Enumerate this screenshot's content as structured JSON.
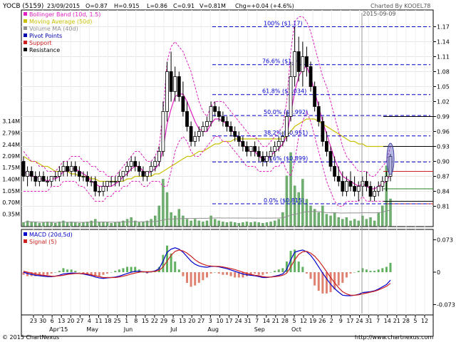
{
  "header": {
    "symbol": "YOCB (5159)",
    "date": "23/09/2015",
    "open": "O=0.87",
    "high": "H=0.915",
    "low": "L=0.86",
    "close": "C=0.91",
    "volume": "V=0.81M",
    "change": "Chg=+0.04 (+4.6%)",
    "charted_by": "Charted By KOOEL78",
    "date_marker": "2015-09-09",
    "copyright": "© 2015 ChartNexus",
    "website": "http://www.chartnexus.com"
  },
  "legend": [
    {
      "label": "Bollinger Band (10d, 1.5)",
      "color": "#e020c0"
    },
    {
      "label": "Moving Average (50d)",
      "color": "#c8c000"
    },
    {
      "label": "Volume MA (40d)",
      "color": "#909090"
    },
    {
      "label": "Pivot Points",
      "color": "#0000aa"
    },
    {
      "label": "Support",
      "color": "#cc2020"
    },
    {
      "label": "Resistance",
      "color": "#000000"
    }
  ],
  "macd_legend": [
    {
      "label": "MACD (20d,5d)",
      "color": "#0000cc"
    },
    {
      "label": "Signal (5)",
      "color": "#cc2020"
    }
  ],
  "colors": {
    "fib": "#0000cc",
    "bb": "#e020c0",
    "ma": "#c8c000",
    "volume": "#70b070",
    "macd_pos": "#60b060",
    "macd_neg": "#e08070",
    "highlight": "#6060c0"
  },
  "chart_data": [
    {
      "type": "candlestick",
      "title": "YOCB (5159)",
      "ylim": [
        0.795,
        1.195
      ],
      "right_ticks": [
        "1.17",
        "1.14",
        "1.11",
        "1.08",
        "1.05",
        "1.02",
        "0.99",
        "0.96",
        "0.93",
        "0.90",
        "0.87",
        "0.84",
        "0.81"
      ],
      "left_ticks": [
        "3.14M",
        "2.79M",
        "2.44M",
        "2.09M",
        "1.75M",
        "1.40M",
        "1.05M",
        "0.70M",
        "0.35M"
      ],
      "fib_levels": [
        {
          "label": "100%  ($1.17)",
          "value": 1.17
        },
        {
          "label": "76.6%  ($1.094)",
          "value": 1.094
        },
        {
          "label": "61.8%  ($1.034)",
          "value": 1.034
        },
        {
          "label": "50.0%  ($0.992)",
          "value": 0.992
        },
        {
          "label": "38.2%  ($0.951)",
          "value": 0.951
        },
        {
          "label": "23.6%  ($0.899)",
          "value": 0.899
        },
        {
          "label": "0.0%  ($0.815)",
          "value": 0.815
        }
      ],
      "pivot_levels": [
        0.99,
        0.93,
        0.88,
        0.845,
        0.82
      ],
      "support_level": 0.815,
      "x_ticks": [
        "23",
        "30",
        "6",
        "13",
        "20",
        "27",
        "4",
        "11",
        "18",
        "25",
        "1",
        "8",
        "15",
        "22",
        "29",
        "6",
        "13",
        "20",
        "27",
        "3",
        "10",
        "17",
        "24",
        "31",
        "7",
        "14",
        "21",
        "28",
        "5",
        "12",
        "19",
        "26",
        "2",
        "9",
        "17",
        "24",
        "31",
        "7",
        "14",
        "21",
        "28",
        "5",
        "12"
      ],
      "month_labels": [
        {
          "label": "Apr'15",
          "index": 2
        },
        {
          "label": "May",
          "index": 6
        },
        {
          "label": "Jun",
          "index": 10
        },
        {
          "label": "Jul",
          "index": 15
        },
        {
          "label": "Aug",
          "index": 19
        },
        {
          "label": "Sep",
          "index": 24
        },
        {
          "label": "Oct",
          "index": 28
        }
      ],
      "ohlc": [
        [
          0.9,
          0.91,
          0.86,
          0.87
        ],
        [
          0.87,
          0.89,
          0.85,
          0.88
        ],
        [
          0.88,
          0.89,
          0.86,
          0.87
        ],
        [
          0.87,
          0.88,
          0.85,
          0.86
        ],
        [
          0.86,
          0.88,
          0.85,
          0.87
        ],
        [
          0.87,
          0.88,
          0.86,
          0.86
        ],
        [
          0.86,
          0.87,
          0.85,
          0.86
        ],
        [
          0.86,
          0.87,
          0.85,
          0.87
        ],
        [
          0.87,
          0.88,
          0.86,
          0.87
        ],
        [
          0.87,
          0.89,
          0.86,
          0.88
        ],
        [
          0.88,
          0.9,
          0.87,
          0.89
        ],
        [
          0.89,
          0.9,
          0.87,
          0.88
        ],
        [
          0.88,
          0.9,
          0.87,
          0.89
        ],
        [
          0.89,
          0.9,
          0.87,
          0.88
        ],
        [
          0.88,
          0.89,
          0.86,
          0.87
        ],
        [
          0.87,
          0.88,
          0.86,
          0.87
        ],
        [
          0.87,
          0.88,
          0.85,
          0.86
        ],
        [
          0.86,
          0.87,
          0.85,
          0.86
        ],
        [
          0.86,
          0.87,
          0.83,
          0.84
        ],
        [
          0.84,
          0.85,
          0.83,
          0.84
        ],
        [
          0.84,
          0.86,
          0.83,
          0.85
        ],
        [
          0.85,
          0.86,
          0.84,
          0.86
        ],
        [
          0.86,
          0.87,
          0.85,
          0.86
        ],
        [
          0.86,
          0.87,
          0.85,
          0.86
        ],
        [
          0.86,
          0.88,
          0.85,
          0.87
        ],
        [
          0.87,
          0.88,
          0.86,
          0.88
        ],
        [
          0.88,
          0.9,
          0.87,
          0.89
        ],
        [
          0.89,
          0.91,
          0.88,
          0.9
        ],
        [
          0.9,
          0.91,
          0.88,
          0.89
        ],
        [
          0.89,
          0.9,
          0.87,
          0.88
        ],
        [
          0.88,
          0.89,
          0.86,
          0.87
        ],
        [
          0.87,
          0.88,
          0.86,
          0.88
        ],
        [
          0.88,
          0.9,
          0.87,
          0.89
        ],
        [
          0.89,
          0.91,
          0.88,
          0.9
        ],
        [
          0.9,
          0.93,
          0.89,
          0.92
        ],
        [
          0.92,
          1.02,
          0.91,
          1.0
        ],
        [
          1.0,
          1.1,
          0.98,
          1.08
        ],
        [
          1.08,
          1.12,
          1.02,
          1.04
        ],
        [
          1.04,
          1.09,
          1.02,
          1.07
        ],
        [
          1.07,
          1.08,
          1.02,
          1.03
        ],
        [
          1.03,
          1.06,
          0.99,
          1.0
        ],
        [
          1.0,
          1.02,
          0.96,
          0.97
        ],
        [
          0.97,
          0.98,
          0.93,
          0.94
        ],
        [
          0.94,
          0.96,
          0.93,
          0.95
        ],
        [
          0.95,
          0.97,
          0.94,
          0.96
        ],
        [
          0.96,
          0.98,
          0.95,
          0.97
        ],
        [
          0.97,
          0.99,
          0.96,
          0.98
        ],
        [
          0.98,
          1.02,
          0.97,
          1.01
        ],
        [
          1.01,
          1.02,
          0.99,
          1.0
        ],
        [
          1.0,
          1.01,
          0.98,
          0.99
        ],
        [
          0.99,
          1.0,
          0.97,
          0.98
        ],
        [
          0.98,
          0.99,
          0.96,
          0.97
        ],
        [
          0.97,
          0.98,
          0.95,
          0.96
        ],
        [
          0.96,
          0.97,
          0.94,
          0.95
        ],
        [
          0.95,
          0.96,
          0.93,
          0.94
        ],
        [
          0.94,
          0.95,
          0.92,
          0.93
        ],
        [
          0.93,
          0.94,
          0.91,
          0.92
        ],
        [
          0.92,
          0.93,
          0.91,
          0.93
        ],
        [
          0.93,
          0.94,
          0.91,
          0.92
        ],
        [
          0.92,
          0.93,
          0.9,
          0.91
        ],
        [
          0.91,
          0.92,
          0.89,
          0.9
        ],
        [
          0.9,
          0.92,
          0.89,
          0.91
        ],
        [
          0.91,
          0.93,
          0.9,
          0.92
        ],
        [
          0.92,
          0.94,
          0.91,
          0.93
        ],
        [
          0.93,
          0.95,
          0.92,
          0.94
        ],
        [
          0.94,
          0.96,
          0.93,
          0.95
        ],
        [
          0.95,
          1.0,
          0.94,
          0.99
        ],
        [
          0.99,
          1.1,
          0.98,
          1.07
        ],
        [
          1.07,
          1.17,
          1.05,
          1.12
        ],
        [
          1.12,
          1.15,
          1.06,
          1.08
        ],
        [
          1.08,
          1.14,
          1.05,
          1.11
        ],
        [
          1.11,
          1.13,
          1.07,
          1.09
        ],
        [
          1.09,
          1.1,
          1.04,
          1.05
        ],
        [
          1.05,
          1.06,
          1.0,
          1.01
        ],
        [
          1.01,
          1.02,
          0.97,
          0.98
        ],
        [
          0.98,
          0.99,
          0.93,
          0.94
        ],
        [
          0.94,
          0.96,
          0.91,
          0.92
        ],
        [
          0.92,
          0.93,
          0.88,
          0.89
        ],
        [
          0.89,
          0.91,
          0.86,
          0.87
        ],
        [
          0.87,
          0.89,
          0.85,
          0.86
        ],
        [
          0.86,
          0.88,
          0.83,
          0.84
        ],
        [
          0.84,
          0.87,
          0.83,
          0.86
        ],
        [
          0.86,
          0.88,
          0.84,
          0.85
        ],
        [
          0.85,
          0.87,
          0.83,
          0.84
        ],
        [
          0.84,
          0.86,
          0.82,
          0.85
        ],
        [
          0.85,
          0.87,
          0.83,
          0.86
        ],
        [
          0.86,
          0.88,
          0.84,
          0.85
        ],
        [
          0.85,
          0.86,
          0.82,
          0.83
        ],
        [
          0.83,
          0.85,
          0.82,
          0.84
        ],
        [
          0.84,
          0.86,
          0.83,
          0.85
        ],
        [
          0.85,
          0.87,
          0.84,
          0.86
        ],
        [
          0.86,
          0.88,
          0.84,
          0.87
        ],
        [
          0.87,
          0.915,
          0.86,
          0.91
        ]
      ],
      "volume_m": [
        0.1,
        0.15,
        0.12,
        0.1,
        0.08,
        0.1,
        0.12,
        0.1,
        0.08,
        0.12,
        0.15,
        0.1,
        0.12,
        0.1,
        0.08,
        0.1,
        0.12,
        0.15,
        0.2,
        0.1,
        0.12,
        0.1,
        0.08,
        0.1,
        0.12,
        0.15,
        0.2,
        0.25,
        0.15,
        0.1,
        0.12,
        0.15,
        0.2,
        0.3,
        0.6,
        1.4,
        1.0,
        0.4,
        0.3,
        0.5,
        0.3,
        0.2,
        0.15,
        0.2,
        0.15,
        0.12,
        0.15,
        0.3,
        0.2,
        0.15,
        0.12,
        0.1,
        0.12,
        0.1,
        0.08,
        0.1,
        0.12,
        0.1,
        0.12,
        0.1,
        0.08,
        0.1,
        0.12,
        0.15,
        0.2,
        0.4,
        1.5,
        2.2,
        1.2,
        1.0,
        1.4,
        0.8,
        0.6,
        0.5,
        0.4,
        0.6,
        0.35,
        0.3,
        0.4,
        0.25,
        0.2,
        0.25,
        0.15,
        0.2,
        0.15,
        0.3,
        0.2,
        0.25,
        0.15,
        0.4,
        0.6,
        1.8,
        0.81
      ],
      "bb_upper": [
        0.92,
        0.91,
        0.9,
        0.9,
        0.89,
        0.89,
        0.88,
        0.88,
        0.88,
        0.89,
        0.9,
        0.9,
        0.91,
        0.91,
        0.91,
        0.9,
        0.9,
        0.89,
        0.89,
        0.88,
        0.88,
        0.87,
        0.87,
        0.87,
        0.88,
        0.89,
        0.9,
        0.91,
        0.92,
        0.92,
        0.91,
        0.9,
        0.9,
        0.91,
        0.93,
        1.0,
        1.1,
        1.13,
        1.14,
        1.13,
        1.12,
        1.1,
        1.08,
        1.05,
        1.02,
        1.0,
        0.99,
        1.01,
        1.02,
        1.02,
        1.02,
        1.01,
        1.0,
        0.99,
        0.98,
        0.97,
        0.96,
        0.95,
        0.95,
        0.94,
        0.93,
        0.93,
        0.94,
        0.95,
        0.96,
        0.97,
        1.02,
        1.12,
        1.18,
        1.19,
        1.19,
        1.18,
        1.16,
        1.13,
        1.1,
        1.07,
        1.05,
        1.02,
        0.99,
        0.96,
        0.93,
        0.91,
        0.9,
        0.89,
        0.88,
        0.88,
        0.88,
        0.87,
        0.87,
        0.88,
        0.89,
        0.9,
        0.93
      ],
      "bb_lower": [
        0.84,
        0.84,
        0.84,
        0.84,
        0.84,
        0.84,
        0.84,
        0.85,
        0.85,
        0.85,
        0.86,
        0.86,
        0.86,
        0.86,
        0.85,
        0.85,
        0.84,
        0.83,
        0.82,
        0.82,
        0.82,
        0.83,
        0.83,
        0.84,
        0.84,
        0.85,
        0.85,
        0.86,
        0.86,
        0.86,
        0.85,
        0.85,
        0.86,
        0.86,
        0.86,
        0.85,
        0.85,
        0.88,
        0.92,
        0.94,
        0.95,
        0.94,
        0.92,
        0.91,
        0.91,
        0.92,
        0.93,
        0.94,
        0.95,
        0.95,
        0.94,
        0.94,
        0.93,
        0.92,
        0.91,
        0.9,
        0.89,
        0.89,
        0.89,
        0.88,
        0.88,
        0.88,
        0.88,
        0.89,
        0.89,
        0.9,
        0.88,
        0.87,
        0.9,
        0.95,
        0.98,
        1.0,
        0.98,
        0.95,
        0.92,
        0.89,
        0.86,
        0.84,
        0.82,
        0.81,
        0.81,
        0.82,
        0.82,
        0.82,
        0.82,
        0.83,
        0.82,
        0.82,
        0.82,
        0.82,
        0.82,
        0.82,
        0.82
      ],
      "ma50": [
        0.91,
        0.905,
        0.9,
        0.9,
        0.895,
        0.89,
        0.89,
        0.885,
        0.88,
        0.88,
        0.88,
        0.88,
        0.875,
        0.875,
        0.87,
        0.87,
        0.87,
        0.865,
        0.865,
        0.86,
        0.86,
        0.86,
        0.86,
        0.86,
        0.86,
        0.86,
        0.865,
        0.865,
        0.87,
        0.87,
        0.87,
        0.87,
        0.87,
        0.875,
        0.875,
        0.88,
        0.885,
        0.89,
        0.895,
        0.9,
        0.905,
        0.91,
        0.91,
        0.915,
        0.92,
        0.92,
        0.925,
        0.93,
        0.935,
        0.935,
        0.94,
        0.94,
        0.94,
        0.945,
        0.945,
        0.945,
        0.945,
        0.945,
        0.945,
        0.945,
        0.945,
        0.945,
        0.945,
        0.945,
        0.945,
        0.945,
        0.95,
        0.96,
        0.97,
        0.975,
        0.98,
        0.985,
        0.985,
        0.985,
        0.98,
        0.975,
        0.97,
        0.965,
        0.96,
        0.955,
        0.95,
        0.945,
        0.94,
        0.94,
        0.935,
        0.935,
        0.93,
        0.93,
        0.93,
        0.93,
        0.93,
        0.93,
        0.93
      ]
    },
    {
      "type": "bar",
      "title": "MACD",
      "ylim": [
        -0.09,
        0.09
      ],
      "ticks": [
        "0.073",
        "0",
        "-0.073"
      ],
      "macd": [
        0.0,
        -0.003,
        -0.005,
        -0.007,
        -0.008,
        -0.009,
        -0.01,
        -0.01,
        -0.009,
        -0.007,
        -0.004,
        -0.003,
        -0.002,
        -0.002,
        -0.003,
        -0.004,
        -0.006,
        -0.008,
        -0.011,
        -0.013,
        -0.014,
        -0.013,
        -0.012,
        -0.011,
        -0.009,
        -0.006,
        -0.003,
        0.0,
        0.002,
        0.002,
        0.001,
        0.0,
        0.001,
        0.003,
        0.008,
        0.025,
        0.045,
        0.052,
        0.055,
        0.052,
        0.045,
        0.035,
        0.025,
        0.018,
        0.014,
        0.012,
        0.011,
        0.013,
        0.013,
        0.012,
        0.01,
        0.008,
        0.005,
        0.002,
        -0.001,
        -0.004,
        -0.006,
        -0.007,
        -0.008,
        -0.01,
        -0.012,
        -0.012,
        -0.011,
        -0.009,
        -0.007,
        -0.004,
        0.006,
        0.028,
        0.045,
        0.048,
        0.05,
        0.046,
        0.038,
        0.026,
        0.012,
        -0.002,
        -0.015,
        -0.027,
        -0.037,
        -0.045,
        -0.052,
        -0.053,
        -0.053,
        -0.052,
        -0.05,
        -0.046,
        -0.045,
        -0.044,
        -0.042,
        -0.038,
        -0.033,
        -0.028,
        -0.018
      ],
      "signal": [
        0.002,
        0.0,
        -0.002,
        -0.004,
        -0.006,
        -0.007,
        -0.008,
        -0.009,
        -0.009,
        -0.008,
        -0.007,
        -0.005,
        -0.004,
        -0.003,
        -0.003,
        -0.003,
        -0.004,
        -0.006,
        -0.008,
        -0.01,
        -0.012,
        -0.012,
        -0.012,
        -0.012,
        -0.011,
        -0.009,
        -0.007,
        -0.004,
        -0.002,
        0.0,
        0.001,
        0.001,
        0.001,
        0.002,
        0.004,
        0.012,
        0.025,
        0.038,
        0.047,
        0.05,
        0.048,
        0.043,
        0.036,
        0.028,
        0.022,
        0.018,
        0.015,
        0.014,
        0.013,
        0.013,
        0.012,
        0.01,
        0.008,
        0.006,
        0.003,
        0.0,
        -0.003,
        -0.005,
        -0.007,
        -0.008,
        -0.01,
        -0.011,
        -0.011,
        -0.01,
        -0.009,
        -0.007,
        -0.002,
        0.012,
        0.028,
        0.04,
        0.046,
        0.047,
        0.043,
        0.036,
        0.026,
        0.014,
        0.001,
        -0.012,
        -0.024,
        -0.035,
        -0.044,
        -0.049,
        -0.052,
        -0.052,
        -0.051,
        -0.049,
        -0.047,
        -0.045,
        -0.043,
        -0.04,
        -0.036,
        -0.032,
        -0.025
      ]
    }
  ]
}
